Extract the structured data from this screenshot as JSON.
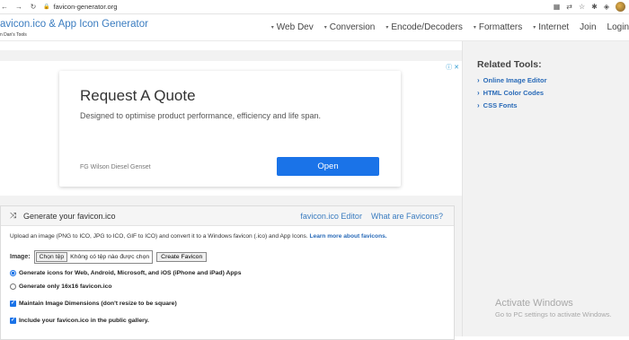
{
  "browser": {
    "url": "favicon-generator.org",
    "back_icon": "arrow-left",
    "forward_icon": "arrow-right",
    "reload_icon": "reload"
  },
  "site": {
    "brand": "avicon.ico & App Icon Generator",
    "brand_sub": "n Dan's Tools",
    "nav": [
      "Web Dev",
      "Conversion",
      "Encode/Decoders",
      "Formatters",
      "Internet",
      "Join",
      "Login"
    ],
    "nav_dropdown": [
      true,
      true,
      true,
      true,
      true,
      false,
      false
    ]
  },
  "ad": {
    "title": "Request A Quote",
    "subtitle": "Designed to optimise product performance, efficiency and life span.",
    "advertiser": "FG Wilson Diesel Genset",
    "button": "Open"
  },
  "generator": {
    "title": "Generate your favicon.ico",
    "link_editor": "favicon.ico Editor",
    "link_what": "What are Favicons?",
    "description": "Upload an image (PNG to ICO, JPG to ICO, GIF to ICO) and convert it to a Windows favicon (.ico) and App Icons.",
    "learn_more": "Learn more about favicons.",
    "image_label": "Image:",
    "choose_file": "Chọn tệp",
    "no_file": "Không có tệp nào được chọn",
    "create_button": "Create Favicon",
    "option_all": "Generate icons for Web, Android, Microsoft, and iOS (iPhone and iPad) Apps",
    "option_16": "Generate only 16x16 favicon.ico",
    "check_dimensions": "Maintain Image Dimensions (don't resize to be square)",
    "check_gallery": "Include your favicon.ico in the public gallery."
  },
  "sidebar": {
    "title": "Related Tools:",
    "items": [
      "Online Image Editor",
      "HTML Color Codes",
      "CSS Fonts"
    ]
  },
  "watermark": {
    "title": "Activate Windows",
    "subtitle": "Go to PC settings to activate Windows."
  },
  "colors": {
    "accent": "#1a73e8",
    "link": "#2a6bb8",
    "brand": "#3a7cc0"
  }
}
